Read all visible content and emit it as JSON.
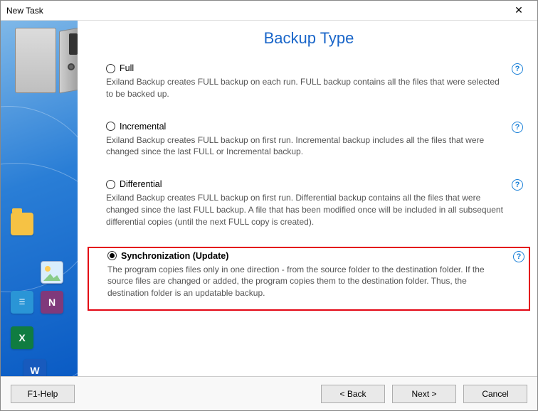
{
  "window": {
    "title": "New Task"
  },
  "page": {
    "heading": "Backup Type"
  },
  "options": {
    "full": {
      "label": "Full",
      "desc": "Exiland Backup creates FULL backup on each run. FULL backup contains all the files that were selected to be backed up."
    },
    "incremental": {
      "label": "Incremental",
      "desc": "Exiland Backup creates FULL backup on first run. Incremental backup includes all the files that were changed since the last FULL or Incremental backup."
    },
    "differential": {
      "label": "Differential",
      "desc": "Exiland Backup creates FULL backup on first run. Differential backup contains all the files that were changed since the last FULL backup. A file that has been modified once will be included in all subsequent differential copies (until the next FULL copy is created)."
    },
    "sync": {
      "label": "Synchronization (Update)",
      "desc": "The program copies files only in one direction - from the source folder to the destination folder. If the source files are changed or added, the program copies them to the destination folder. Thus, the destination folder is an updatable backup."
    }
  },
  "buttons": {
    "help": "F1-Help",
    "back": "<  Back",
    "next": "Next  >",
    "cancel": "Cancel"
  },
  "icons": {
    "onenote": "N",
    "excel": "X",
    "word": "W",
    "contact": "☰",
    "help": "?",
    "close": "✕"
  }
}
